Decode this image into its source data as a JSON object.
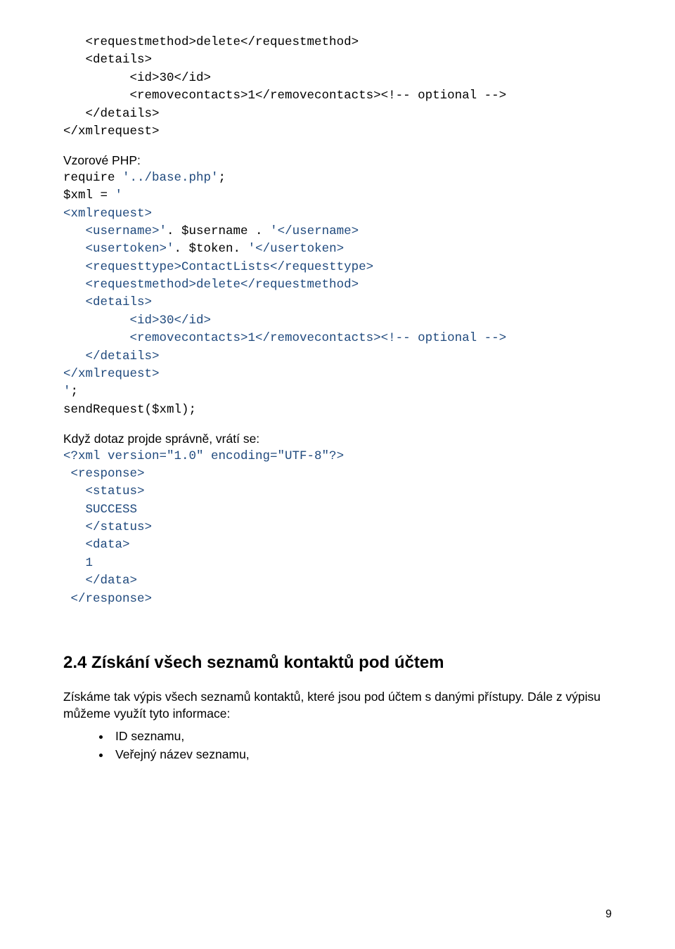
{
  "xmlTop": {
    "l1": "   <requestmethod>delete</requestmethod>",
    "l2": "   <details>",
    "l3": "         <id>30</id>",
    "l4": "         <removecontacts>1</removecontacts><!-- optional -->",
    "l5": "   </details>",
    "l6": "</xmlrequest>"
  },
  "labelVzor": "Vzorové PHP:",
  "php": {
    "l1a": "require ",
    "l1b": "'../base.php'",
    "l1c": ";",
    "l2a": "$xml = ",
    "l2b": "'",
    "l3": "<xmlrequest>",
    "l4a": "   <username>'",
    "l4b": ". $username . ",
    "l4c": "'</username>",
    "l5a": "   <usertoken>'",
    "l5b": ". $token. ",
    "l5c": "'</usertoken>",
    "l6": "   <requesttype>ContactLists</requesttype>",
    "l7": "   <requestmethod>delete</requestmethod>",
    "l8": "   <details>",
    "l9": "         <id>30</id>",
    "l10": "         <removecontacts>1</removecontacts><!-- optional -->",
    "l11": "   </details>",
    "l12": "</xmlrequest>",
    "l13a": "'",
    "l13b": ";",
    "l14": "sendRequest($xml);"
  },
  "labelKdyz": "Když dotaz projde správně, vrátí se:",
  "resp": {
    "l1": "<?xml version=\"1.0\" encoding=\"UTF-8\"?>",
    "l2": " <response>",
    "l3": "   <status>",
    "l4": "   SUCCESS",
    "l5": "   </status>",
    "l6": "   <data>",
    "l7": "   1",
    "l8": "   </data>",
    "l9": " </response>"
  },
  "heading": "2.4 Získání všech seznamů kontaktů pod účtem",
  "para": "Získáme tak výpis všech seznamů kontaktů, které jsou pod účtem s danými přístupy. Dále z výpisu můžeme využít tyto informace:",
  "bullets": {
    "b1": "ID seznamu,",
    "b2": "Veřejný název seznamu,"
  },
  "pageNumber": "9"
}
